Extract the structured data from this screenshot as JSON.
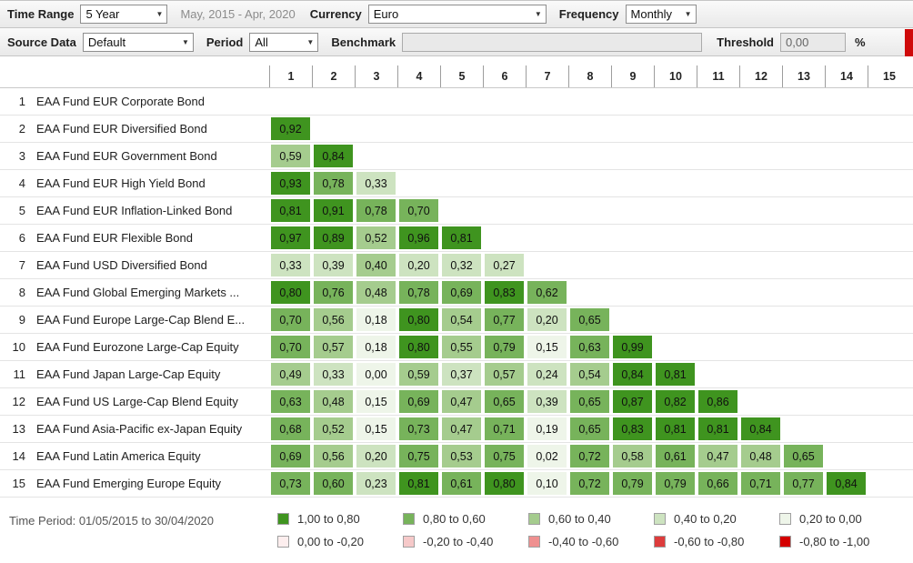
{
  "toolbar_primary": {
    "time_range_label": "Time Range",
    "time_range_value": "5 Year",
    "date_range": "May, 2015 - Apr, 2020",
    "currency_label": "Currency",
    "currency_value": "Euro",
    "frequency_label": "Frequency",
    "frequency_value": "Monthly"
  },
  "toolbar_secondary": {
    "source_data_label": "Source Data",
    "source_data_value": "Default",
    "period_label": "Period",
    "period_value": "All",
    "benchmark_label": "Benchmark",
    "benchmark_value": "",
    "threshold_label": "Threshold",
    "threshold_value": "0,00",
    "percent_label": "%"
  },
  "matrix": {
    "column_headers": [
      "1",
      "2",
      "3",
      "4",
      "5",
      "6",
      "7",
      "8",
      "9",
      "10",
      "11",
      "12",
      "13",
      "14",
      "15"
    ],
    "rows": [
      {
        "num": "1",
        "name": "EAA Fund EUR Corporate Bond",
        "values": []
      },
      {
        "num": "2",
        "name": "EAA Fund EUR Diversified Bond",
        "values": [
          "0,92"
        ]
      },
      {
        "num": "3",
        "name": "EAA Fund EUR Government Bond",
        "values": [
          "0,59",
          "0,84"
        ]
      },
      {
        "num": "4",
        "name": "EAA Fund EUR High Yield Bond",
        "values": [
          "0,93",
          "0,78",
          "0,33"
        ]
      },
      {
        "num": "5",
        "name": "EAA Fund EUR Inflation-Linked Bond",
        "values": [
          "0,81",
          "0,91",
          "0,78",
          "0,70"
        ]
      },
      {
        "num": "6",
        "name": "EAA Fund EUR Flexible Bond",
        "values": [
          "0,97",
          "0,89",
          "0,52",
          "0,96",
          "0,81"
        ]
      },
      {
        "num": "7",
        "name": "EAA Fund USD Diversified Bond",
        "values": [
          "0,33",
          "0,39",
          "0,40",
          "0,20",
          "0,32",
          "0,27"
        ]
      },
      {
        "num": "8",
        "name": "EAA Fund Global Emerging Markets ...",
        "values": [
          "0,80",
          "0,76",
          "0,48",
          "0,78",
          "0,69",
          "0,83",
          "0,62"
        ]
      },
      {
        "num": "9",
        "name": "EAA Fund Europe Large-Cap Blend E...",
        "values": [
          "0,70",
          "0,56",
          "0,18",
          "0,80",
          "0,54",
          "0,77",
          "0,20",
          "0,65"
        ]
      },
      {
        "num": "10",
        "name": "EAA Fund Eurozone Large-Cap Equity",
        "values": [
          "0,70",
          "0,57",
          "0,18",
          "0,80",
          "0,55",
          "0,79",
          "0,15",
          "0,63",
          "0,99"
        ]
      },
      {
        "num": "11",
        "name": "EAA Fund Japan Large-Cap Equity",
        "values": [
          "0,49",
          "0,33",
          "0,00",
          "0,59",
          "0,37",
          "0,57",
          "0,24",
          "0,54",
          "0,84",
          "0,81"
        ]
      },
      {
        "num": "12",
        "name": "EAA Fund US Large-Cap Blend Equity",
        "values": [
          "0,63",
          "0,48",
          "0,15",
          "0,69",
          "0,47",
          "0,65",
          "0,39",
          "0,65",
          "0,87",
          "0,82",
          "0,86"
        ]
      },
      {
        "num": "13",
        "name": "EAA Fund Asia-Pacific ex-Japan Equity",
        "values": [
          "0,68",
          "0,52",
          "0,15",
          "0,73",
          "0,47",
          "0,71",
          "0,19",
          "0,65",
          "0,83",
          "0,81",
          "0,81",
          "0,84"
        ]
      },
      {
        "num": "14",
        "name": "EAA Fund Latin America Equity",
        "values": [
          "0,69",
          "0,56",
          "0,20",
          "0,75",
          "0,53",
          "0,75",
          "0,02",
          "0,72",
          "0,58",
          "0,61",
          "0,47",
          "0,48",
          "0,65"
        ]
      },
      {
        "num": "15",
        "name": "EAA Fund Emerging Europe Equity",
        "values": [
          "0,73",
          "0,60",
          "0,23",
          "0,81",
          "0,61",
          "0,80",
          "0,10",
          "0,72",
          "0,79",
          "0,79",
          "0,66",
          "0,71",
          "0,77",
          "0,84"
        ]
      }
    ]
  },
  "footer": {
    "time_period": "Time Period: 01/05/2015 to 30/04/2020",
    "legend": [
      {
        "label": "1,00 to 0,80",
        "color": "#3f941f"
      },
      {
        "label": "0,80 to 0,60",
        "color": "#77b35b"
      },
      {
        "label": "0,60 to 0,40",
        "color": "#a5cc8e"
      },
      {
        "label": "0,40 to 0,20",
        "color": "#cde3c0"
      },
      {
        "label": "0,20 to 0,00",
        "color": "#eef5e9"
      },
      {
        "label": "0,00 to -0,20",
        "color": "#fdeeee"
      },
      {
        "label": "-0,20 to -0,40",
        "color": "#f6c9c9"
      },
      {
        "label": "-0,40 to -0,60",
        "color": "#ef9090"
      },
      {
        "label": "-0,60 to -0,80",
        "color": "#dd3c3c"
      },
      {
        "label": "-0,80 to -1,00",
        "color": "#d40000"
      }
    ]
  }
}
